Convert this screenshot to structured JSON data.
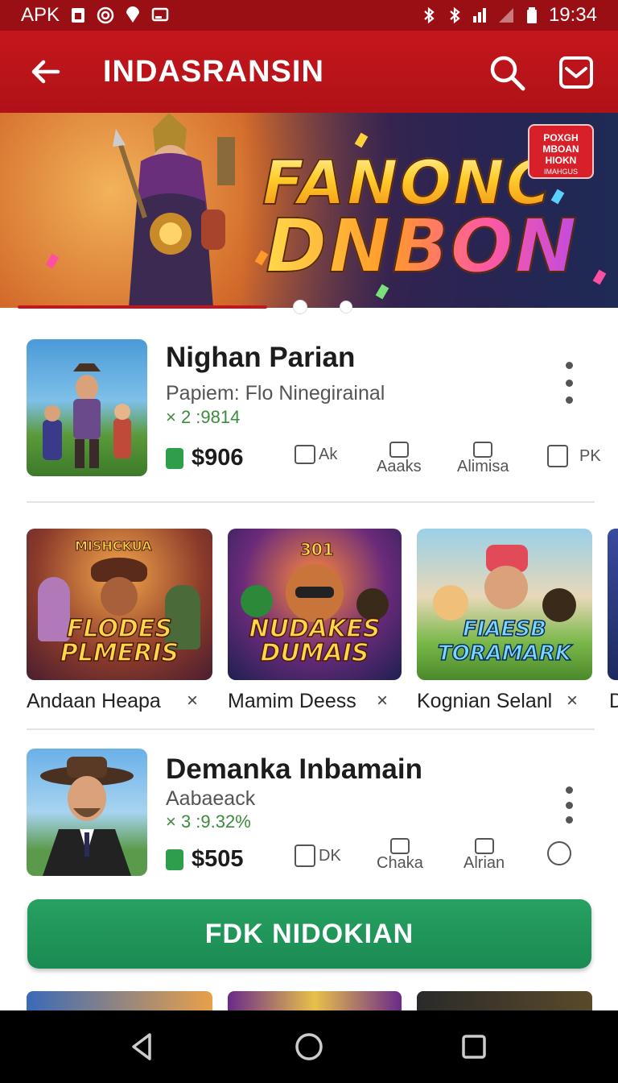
{
  "status_bar": {
    "carrier": "APK",
    "time": "19:34",
    "icons": [
      "sim-icon",
      "target-icon",
      "location-icon",
      "cast-icon",
      "bluetooth-icon",
      "bluetooth-alt-icon",
      "signal-icon",
      "cell-signal-icon",
      "battery-icon"
    ]
  },
  "app_bar": {
    "title": "INDASRANSIN",
    "back_icon": "arrow-left-icon",
    "search_icon": "search-icon",
    "mail_icon": "mail-icon"
  },
  "banner": {
    "line1": "FANONC",
    "line2": "DNBON",
    "badge_lines": [
      "POXGH",
      "MBOAN",
      "HIOKN"
    ],
    "badge_small": "IMAHGUS",
    "page_count": 3,
    "active_page": 1
  },
  "featured_apps": [
    {
      "name": "Nighan Parian",
      "subtitle": "Papiem: Flo Ninegirainal",
      "rating": "× 2 :9814",
      "price": "$906",
      "actions": [
        "Ak",
        "Aaaks",
        "Alimisa",
        "PK"
      ]
    },
    {
      "name": "Demanka Inbamain",
      "subtitle": "Aabaeack",
      "rating": "× 3 :9.32%",
      "price": "$505",
      "actions": [
        "DK",
        "Chaka",
        "Alrian",
        ""
      ]
    }
  ],
  "carousel": [
    {
      "caption": "Andaan Heapa",
      "art_title_top": "MISHCKUA",
      "art_title": "FLODES PLMERIS",
      "close": "×"
    },
    {
      "caption": "Mamim Deess",
      "art_title_top": "301",
      "art_title": "NUDAKES DUMAIS",
      "close": "×"
    },
    {
      "caption": "Kognian Selanl",
      "art_title_top": "",
      "art_title": "FIAESB TORAMARK",
      "close": "×"
    },
    {
      "caption": "D",
      "art_title_top": "",
      "art_title": "",
      "close": ""
    }
  ],
  "cta": {
    "label": "FDK NIDOKIAN"
  },
  "nav_bar": {
    "back_icon": "triangle-back-icon",
    "home_icon": "circle-home-icon",
    "recents_icon": "square-recents-icon"
  },
  "colors": {
    "primary": "#c4161c",
    "accent_green": "#1f9457",
    "rating_green": "#3d8b3d"
  }
}
